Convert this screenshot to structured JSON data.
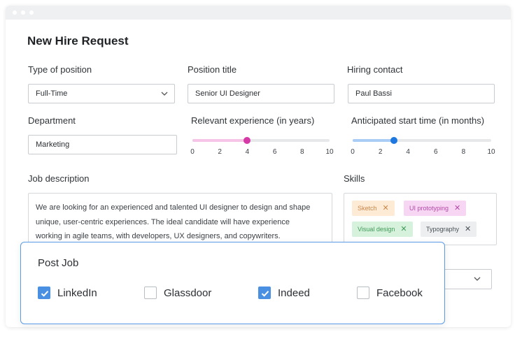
{
  "form": {
    "title": "New Hire Request",
    "type_of_position": {
      "label": "Type of position",
      "value": "Full-Time"
    },
    "position_title": {
      "label": "Position title",
      "value": "Senior UI Designer"
    },
    "hiring_contact": {
      "label": "Hiring contact",
      "value": "Paul Bassi"
    },
    "department": {
      "label": "Department",
      "value": "Marketing"
    },
    "experience": {
      "label": "Relevant experience (in years)",
      "value": 4,
      "min": 0,
      "max": 10,
      "ticks": [
        "0",
        "2",
        "4",
        "6",
        "8",
        "10"
      ],
      "color": "#d63aa6",
      "fill_color": "#f6c4e6"
    },
    "start_time": {
      "label": "Anticipated start time (in months)",
      "value": 3,
      "min": 0,
      "max": 10,
      "ticks": [
        "0",
        "2",
        "4",
        "6",
        "8",
        "10"
      ],
      "color": "#1f78e0",
      "fill_color": "#a9cdf4"
    },
    "job_description": {
      "label": "Job description",
      "lines": [
        "We are looking for an experienced and talented UI designer to design and shape",
        "unique, user-centric experiences. The ideal candidate will have experience",
        "working in agile teams, with developers, UX designers, and copywriters."
      ]
    },
    "skills": {
      "label": "Skills",
      "tags": [
        {
          "text": "Sketch",
          "bg": "#fdebd6",
          "fg": "#c9874a"
        },
        {
          "text": "UI prototyping",
          "bg": "#f6d6f2",
          "fg": "#b44aa8"
        },
        {
          "text": "Visual design",
          "bg": "#d6f1dc",
          "fg": "#3f9a57"
        },
        {
          "text": "Typography",
          "bg": "#eceeef",
          "fg": "#4a5056"
        }
      ],
      "remove_icon": "close-icon"
    }
  },
  "post_job": {
    "title": "Post Job",
    "options": [
      {
        "label": "LinkedIn",
        "checked": true
      },
      {
        "label": "Glassdoor",
        "checked": false
      },
      {
        "label": "Indeed",
        "checked": true
      },
      {
        "label": "Facebook",
        "checked": false
      }
    ]
  },
  "colors": {
    "accent": "#4a90e2",
    "modal_border": "#5b9ae6"
  }
}
